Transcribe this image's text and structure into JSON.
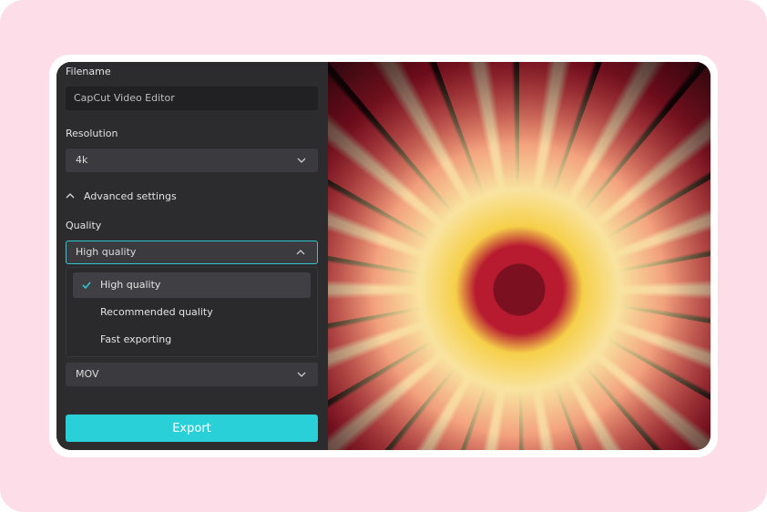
{
  "form": {
    "filename_label": "Filename",
    "filename_value": "CapCut Video Editor",
    "resolution_label": "Resolution",
    "resolution_value": "4k",
    "advanced_label": "Advanced settings",
    "quality_label": "Quality",
    "quality_value": "High quality",
    "quality_options": [
      {
        "label": "High quality",
        "selected": true
      },
      {
        "label": "Recommended quality",
        "selected": false
      },
      {
        "label": "Fast exporting",
        "selected": false
      }
    ],
    "format_value": "MOV",
    "export_label": "Export"
  },
  "colors": {
    "accent": "#29d0d8",
    "panel": "#2c2c2f",
    "background": "#fddde8"
  },
  "preview": {
    "image": "red and yellow dahlia flower close-up"
  }
}
